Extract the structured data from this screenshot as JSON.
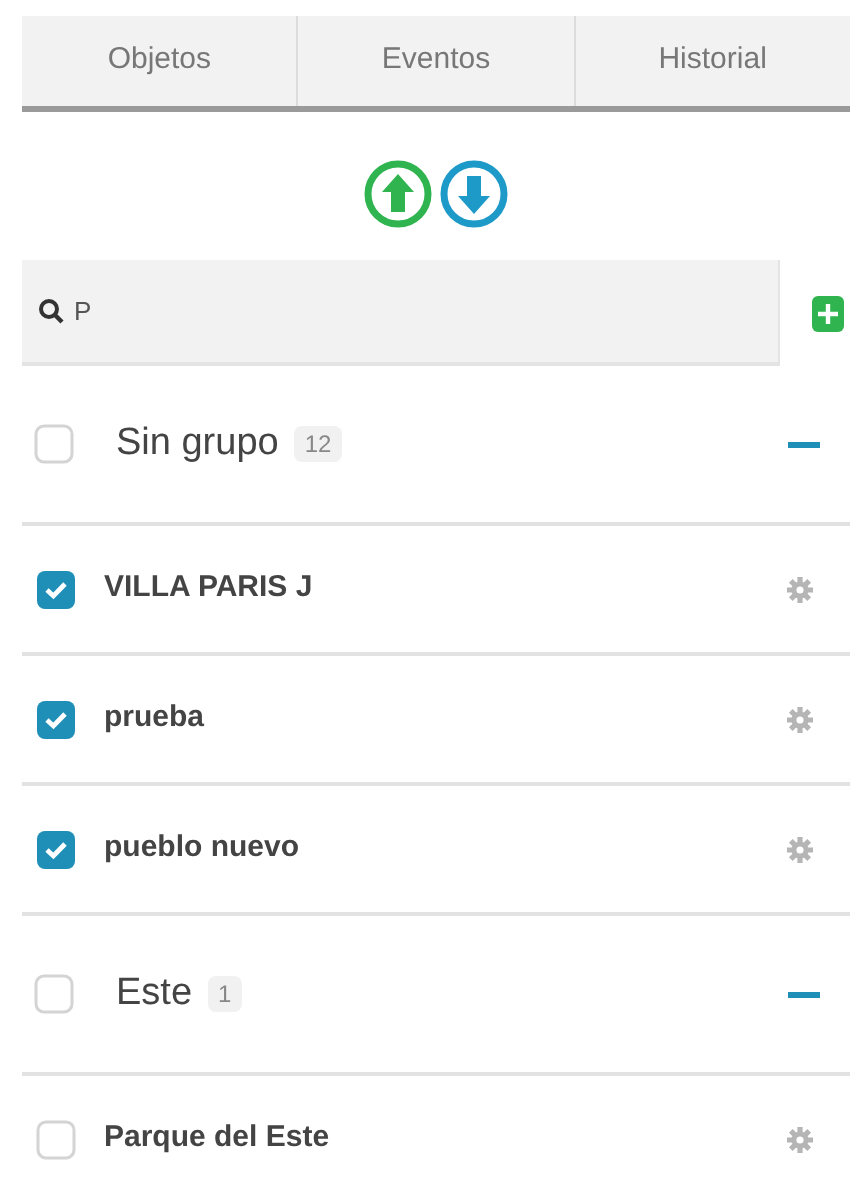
{
  "tabs": [
    {
      "label": "Objetos"
    },
    {
      "label": "Eventos"
    },
    {
      "label": "Historial"
    }
  ],
  "search": {
    "value": "P"
  },
  "groups": [
    {
      "name": "Sin grupo",
      "count": "12",
      "checked": false,
      "expanded": true,
      "children": [
        {
          "name": "VILLA PARIS J",
          "checked": true
        },
        {
          "name": "prueba",
          "checked": true
        },
        {
          "name": "pueblo nuevo",
          "checked": true
        }
      ]
    },
    {
      "name": "Este",
      "count": "1",
      "checked": false,
      "expanded": true,
      "children": [
        {
          "name": "Parque del Este",
          "checked": false
        }
      ]
    }
  ]
}
